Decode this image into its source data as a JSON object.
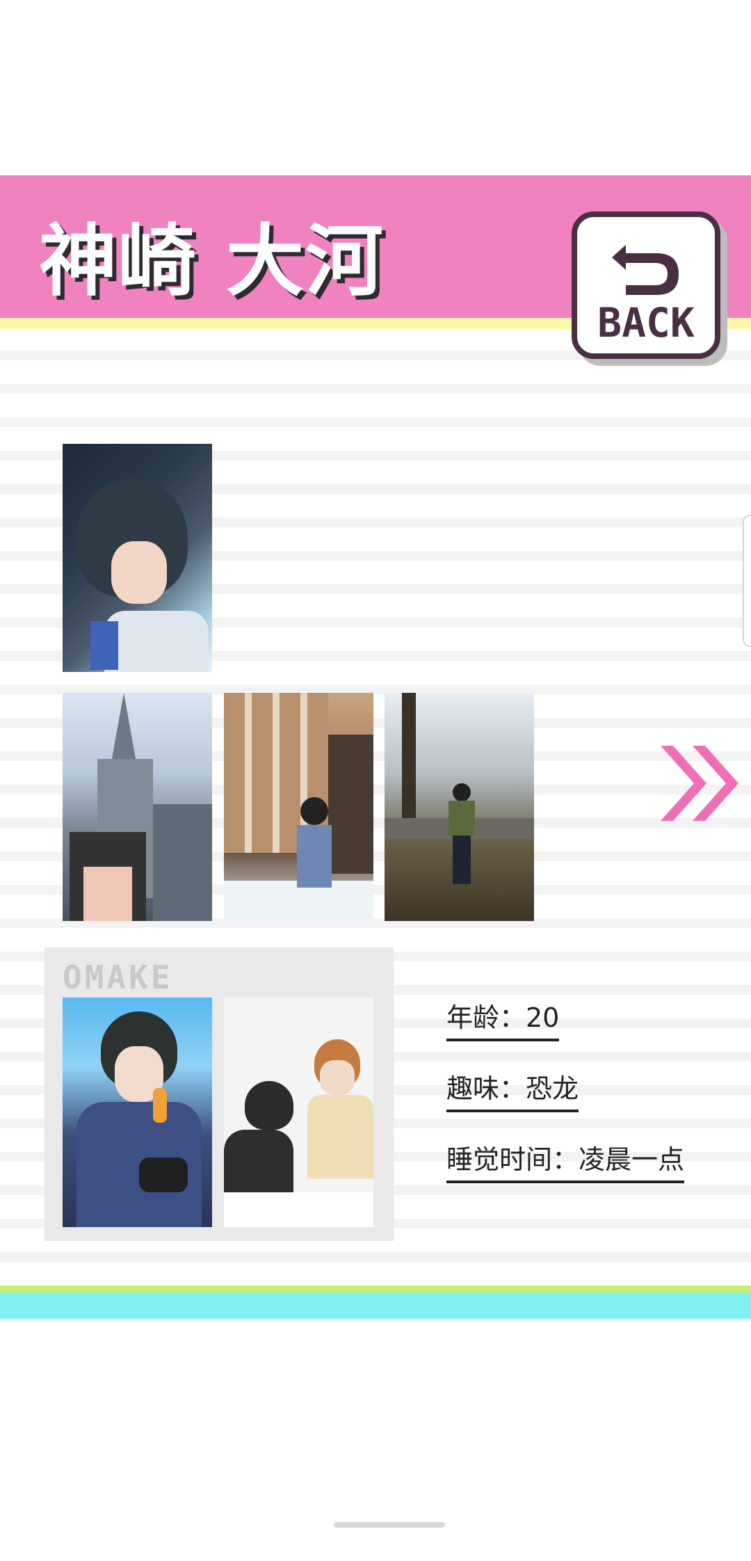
{
  "header": {
    "title": "神崎 大河",
    "back_label": "BACK"
  },
  "gallery": {
    "next_label": ">>"
  },
  "omake": {
    "label": "OMAKE"
  },
  "profile": {
    "age": "年龄：20",
    "hobby": "趣味：恐龙",
    "sleep_time": "睡觉时间：凌晨一点"
  },
  "colors": {
    "header_pink": "#ef82bf",
    "header_yellow": "#fbf7a8",
    "back_border": "#4a2f44",
    "arrow_pink": "#ef6fb4",
    "band_green": "#c7f06c",
    "band_cyan": "#7ef0f2"
  },
  "icons": {
    "back": "back-arrow-icon",
    "next": "double-chevron-right-icon"
  }
}
